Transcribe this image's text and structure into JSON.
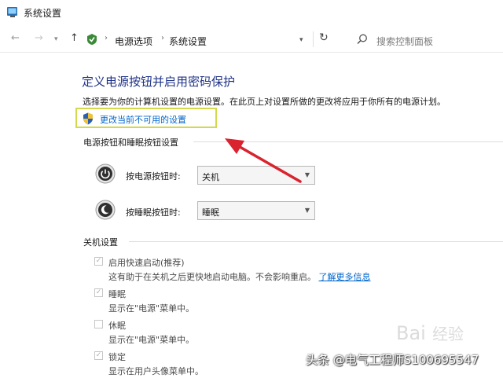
{
  "window": {
    "title": "系统设置"
  },
  "address": {
    "breadcrumb": [
      "电源选项",
      "系统设置"
    ],
    "search_placeholder": "搜索控制面板"
  },
  "page": {
    "heading": "定义电源按钮并启用密码保护",
    "description": "选择要为你的计算机设置的电源设置。在此页上对设置所做的更改将应用于你所有的电源计划。",
    "change_link": "更改当前不可用的设置"
  },
  "buttons_section": {
    "title": "电源按钮和睡眠按钮设置",
    "rows": [
      {
        "label": "按电源按钮时:",
        "value": "关机",
        "icon": "power-icon"
      },
      {
        "label": "按睡眠按钮时:",
        "value": "睡眠",
        "icon": "sleep-moon-icon"
      }
    ]
  },
  "shutdown_section": {
    "title": "关机设置",
    "options": [
      {
        "title": "启用快速启动(推荐)",
        "desc": "这有助于在关机之后更快地启动电脑。不会影响重启。",
        "link": "了解更多信息",
        "checked": true
      },
      {
        "title": "睡眠",
        "desc": "显示在\"电源\"菜单中。",
        "checked": true
      },
      {
        "title": "休眠",
        "desc": "显示在\"电源\"菜单中。",
        "checked": false
      },
      {
        "title": "锁定",
        "desc": "显示在用户头像菜单中。",
        "checked": true
      }
    ]
  },
  "watermark": {
    "caption": "头条 @电气工程师S100695547",
    "logo_text": "Baidu经验"
  },
  "colors": {
    "heading": "#1e3287",
    "link": "#0066cc",
    "highlight_box": "#d3d94a",
    "arrow": "#d9232e"
  }
}
